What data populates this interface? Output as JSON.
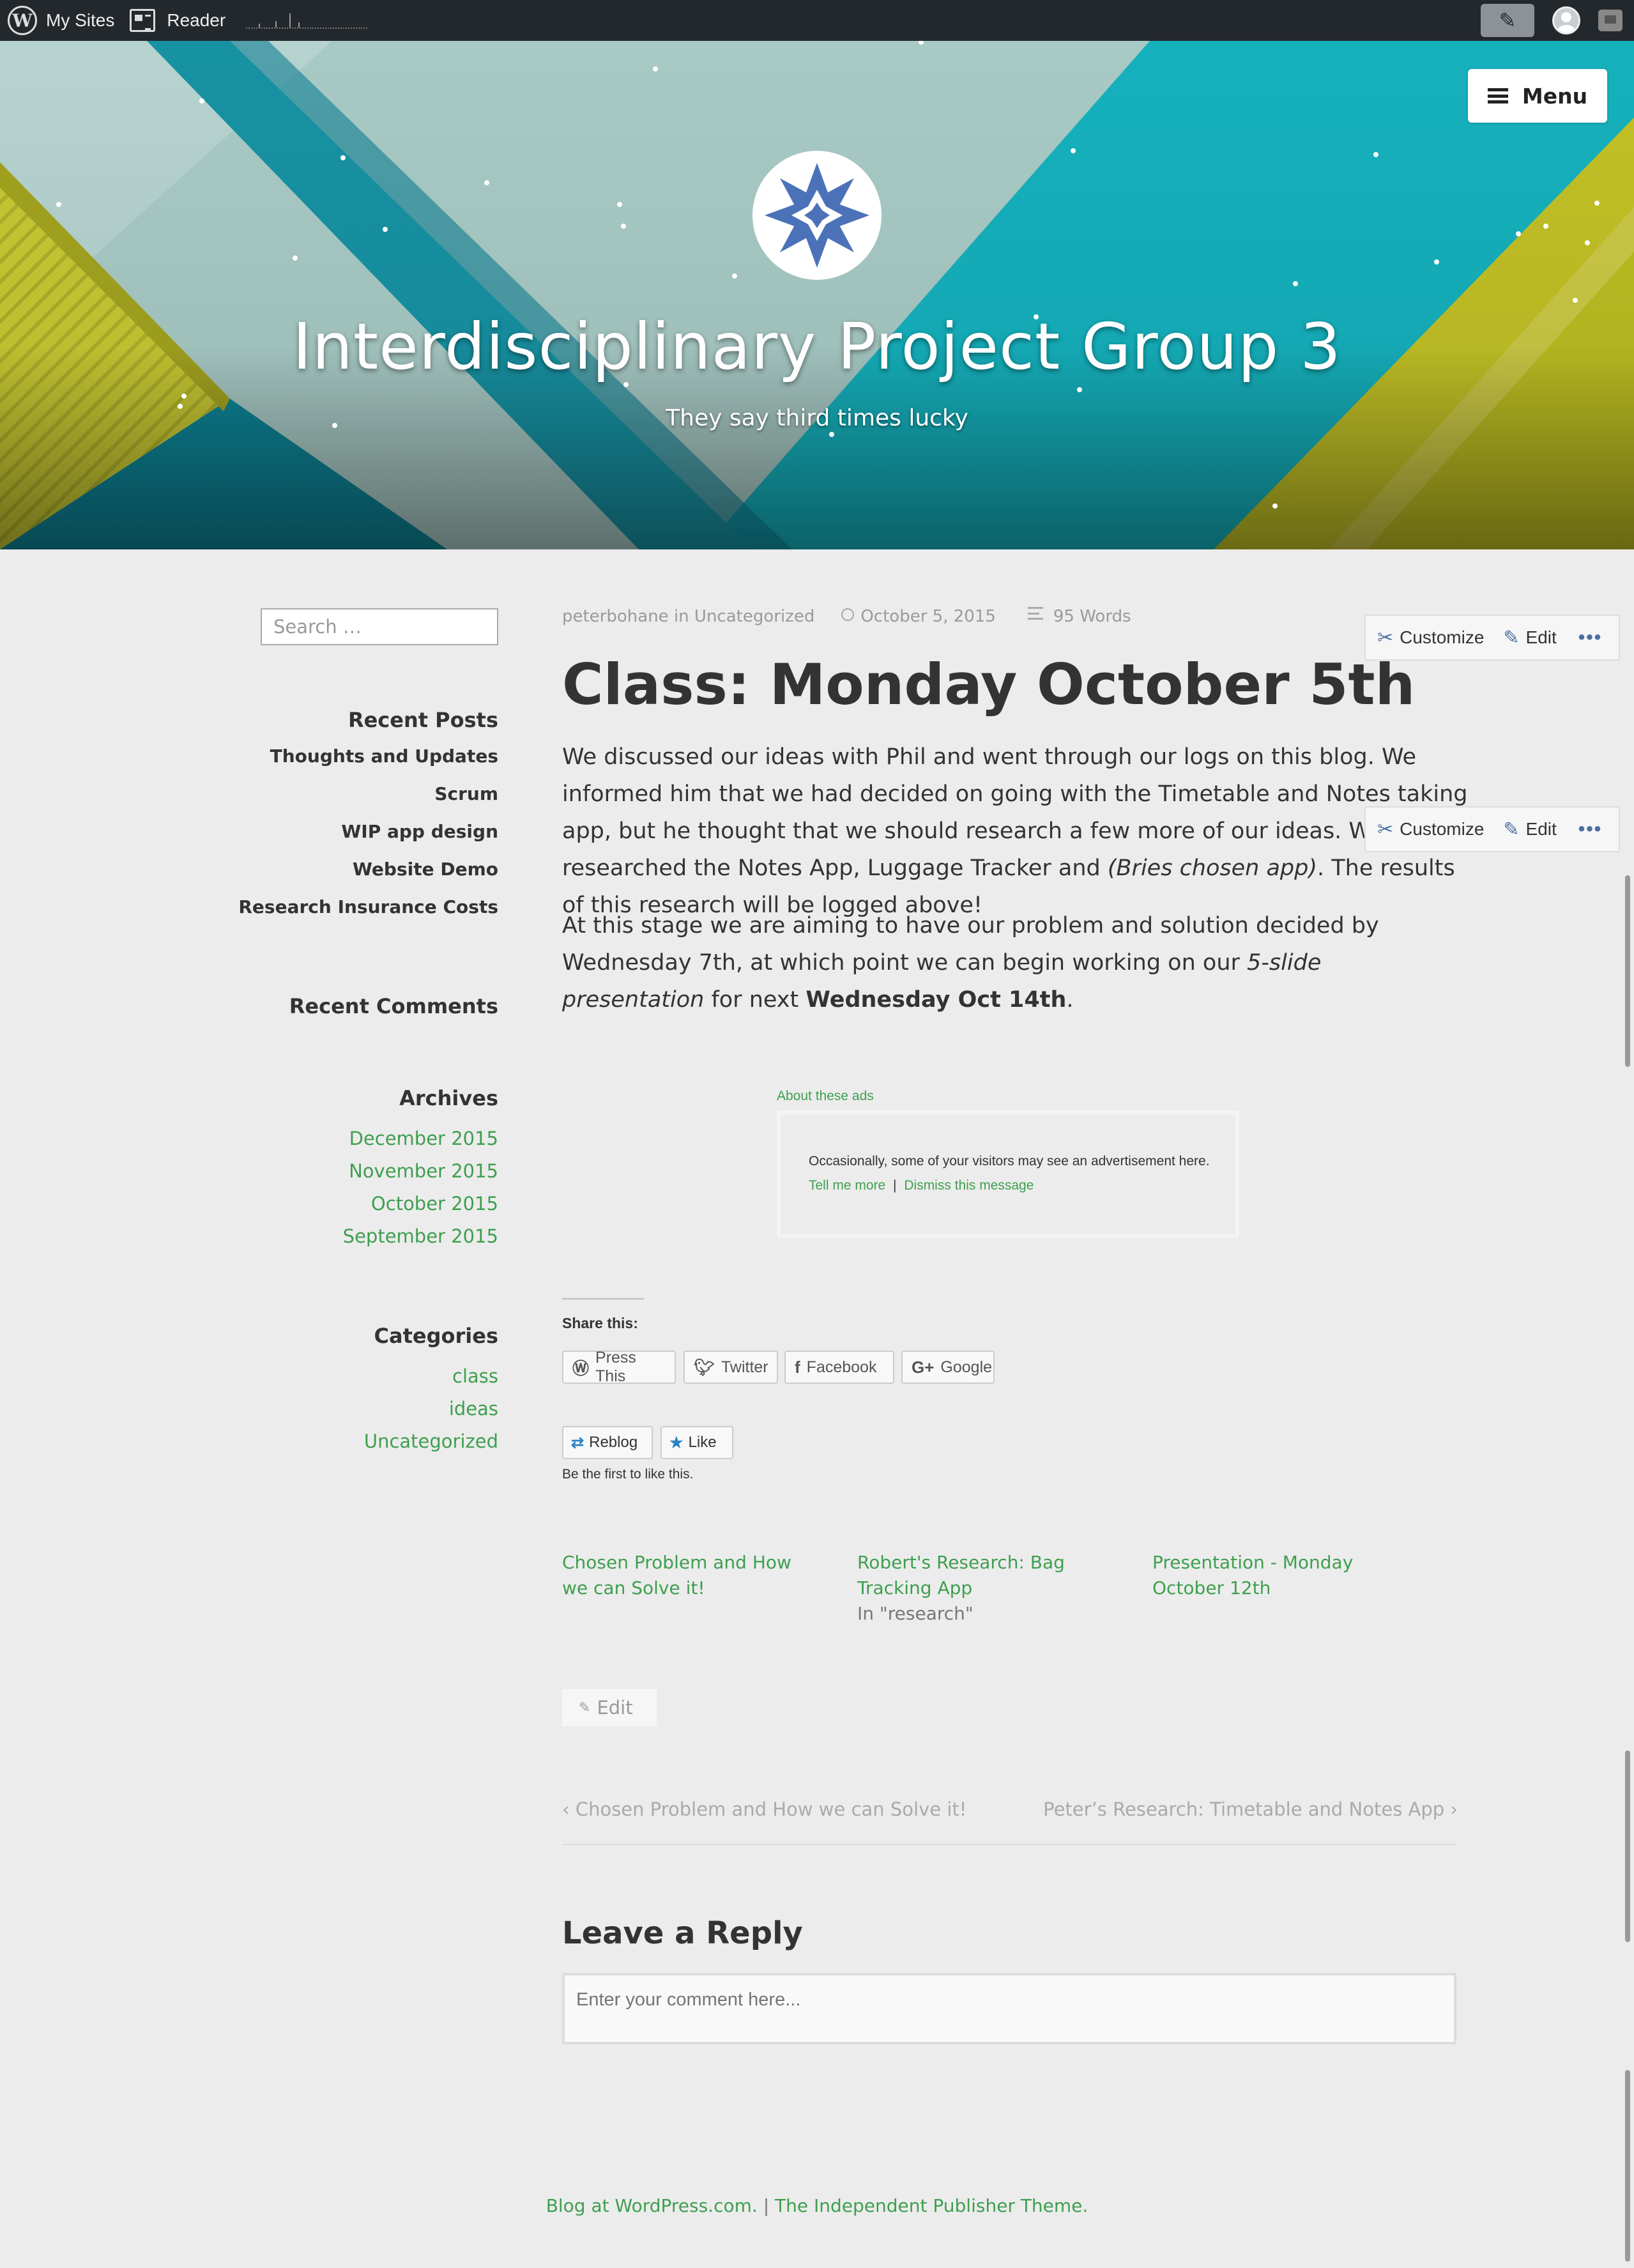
{
  "adminbar": {
    "my_sites": "My Sites",
    "reader": "Reader"
  },
  "header": {
    "menu_label": "Menu",
    "site_title": "Interdisciplinary Project Group 3",
    "tagline": "They say third times lucky"
  },
  "sidebar": {
    "search_placeholder": "Search …",
    "recent_posts_title": "Recent Posts",
    "recent_posts": [
      "Thoughts and Updates",
      "Scrum",
      "WIP app design",
      "Website Demo",
      "Research Insurance Costs"
    ],
    "recent_comments_title": "Recent Comments",
    "archives_title": "Archives",
    "archives": [
      "December 2015",
      "November 2015",
      "October 2015",
      "September 2015"
    ],
    "categories_title": "Categories",
    "categories": [
      "class",
      "ideas",
      "Uncategorized"
    ]
  },
  "post": {
    "author": "peterbohane",
    "in_word": "in",
    "category": "Uncategorized",
    "date": "October 5, 2015",
    "word_count": "95 Words",
    "title": "Class: Monday October 5th",
    "p1_a": "We discussed our ideas with Phil and went through our logs on this blog. We informed him that we had decided on going with the Timetable and Notes taking app, but he thought that we should research a few more of our ideas. We researched the Notes App, Luggage Tracker and ",
    "p1_em": "(Bries chosen app)",
    "p1_b": ". The results of this research will be logged above!",
    "p2_a": "At this stage we are aiming to have our problem and solution decided by Wednesday 7th, at which point we can begin working on our ",
    "p2_em": "5-slide presentation",
    "p2_b": " for next ",
    "p2_strong": "Wednesday Oct 14th",
    "p2_c": "."
  },
  "edit_bar": {
    "customize": "Customize",
    "edit": "Edit"
  },
  "ads": {
    "about": "About these ads",
    "message": "Occasionally, some of your visitors may see an advertisement here.",
    "tell_more": "Tell me more",
    "separator": "|",
    "dismiss": "Dismiss this message"
  },
  "share": {
    "title": "Share this:",
    "buttons": [
      "Press This",
      "Twitter",
      "Facebook",
      "Google"
    ]
  },
  "likes": {
    "reblog": "Reblog",
    "like": "Like",
    "first_text": "Be the first to like this."
  },
  "related": [
    {
      "title": "Chosen Problem and How we can Solve it!",
      "context": ""
    },
    {
      "title": "Robert's Research: Bag Tracking App",
      "context": "In \"research\""
    },
    {
      "title": "Presentation - Monday October 12th",
      "context": ""
    }
  ],
  "edit_link": "Edit",
  "post_nav": {
    "prev": "Chosen Problem and How we can Solve it!",
    "next": "Peter’s Research: Timetable and Notes App"
  },
  "reply": {
    "title": "Leave a Reply",
    "placeholder": "Enter your comment here..."
  },
  "footer": {
    "blog_at": "Blog at WordPress.com.",
    "separator": "|",
    "theme": "The Independent Publisher Theme."
  },
  "colors": {
    "accent_green": "#3e9f4f",
    "adminbar_bg": "#23282d",
    "page_bg": "#ececec"
  }
}
